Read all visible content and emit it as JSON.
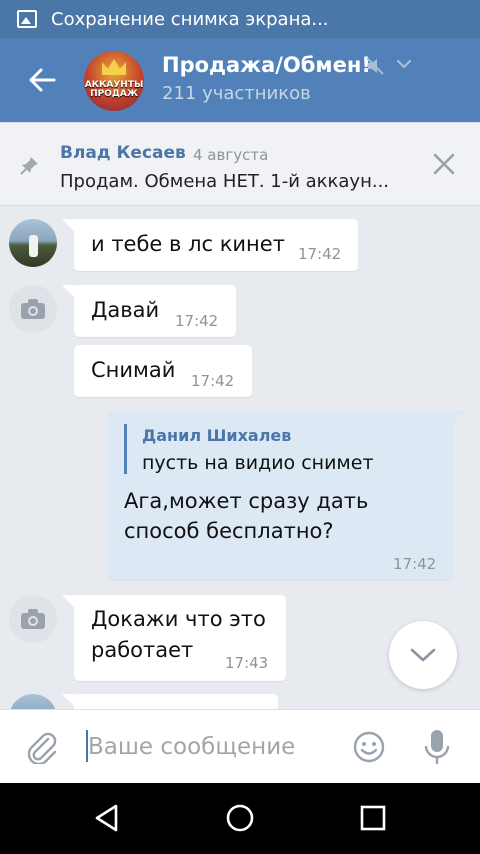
{
  "status_bar": {
    "notification_text": "Сохранение снимка экрана..."
  },
  "header": {
    "title": "Продажа/Обмен!",
    "subtitle": "211 участников",
    "avatar_caption": "АККАУНТЫ ПРОДАЖ"
  },
  "pinned": {
    "author": "Влад Кесаев",
    "date": "4 августа",
    "text": "Продам. Обмена НЕТ.  1-й аккаун..."
  },
  "messages": [
    {
      "text": "и тебе в лс кинет",
      "time": "17:42"
    },
    {
      "text": "Давай",
      "time": "17:42"
    },
    {
      "text": "Снимай",
      "time": "17:42"
    },
    {
      "reply_name": "Данил Шихалев",
      "reply_text": "пусть на видио снимет",
      "line1": "Ага,может сразу дать",
      "line2": "способ бесплатно?",
      "time": "17:42"
    },
    {
      "line1": "Докажи что это",
      "line2": "работает",
      "time": "17:43"
    }
  ],
  "input": {
    "placeholder": "Ваше сообщение",
    "value": ""
  },
  "colors": {
    "header": "#5181b8",
    "status_bar": "#4a76a8",
    "accent": "#4a76a8",
    "outgoing_bubble": "#dde8f5",
    "chat_background": "#e7ebf0"
  }
}
